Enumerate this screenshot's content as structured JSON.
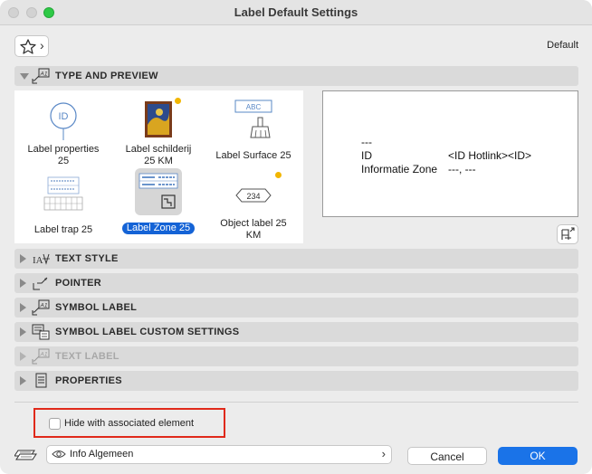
{
  "window": {
    "title": "Label Default Settings"
  },
  "toolbar": {
    "favorites_icon": "star-icon",
    "default_label": "Default"
  },
  "panels": {
    "type_and_preview": "TYPE AND PREVIEW",
    "text_style": "TEXT STYLE",
    "pointer": "POINTER",
    "symbol_label": "SYMBOL LABEL",
    "symbol_label_custom": "SYMBOL LABEL CUSTOM SETTINGS",
    "text_label": "TEXT LABEL",
    "properties": "PROPERTIES"
  },
  "label_types": [
    {
      "name": "Label properties 25",
      "line1": "Label properties",
      "line2": "25"
    },
    {
      "name": "Label schilderij 25 KM",
      "line1": "Label schilderij",
      "line2": "25 KM"
    },
    {
      "name": "Label Surface 25",
      "line1": "Label Surface 25",
      "line2": ""
    },
    {
      "name": "Label trap 25",
      "line1": "Label trap 25",
      "line2": ""
    },
    {
      "name": "Label Zone 25",
      "line1": "Label Zone 25",
      "line2": "",
      "selected": true
    },
    {
      "name": "Object label 25 KM",
      "line1": "Object label 25",
      "line2": "KM"
    }
  ],
  "thumb_text": {
    "id": "ID",
    "abc": "ABC",
    "num": "234"
  },
  "preview": {
    "line1": "---",
    "line2_left": "ID",
    "line2_right": "<ID Hotlink><ID>",
    "line3_left": "Informatie Zone",
    "line3_right": "---, ---"
  },
  "hide_option": {
    "label": "Hide with associated element",
    "checked": false
  },
  "layer": {
    "value": "Info Algemeen"
  },
  "buttons": {
    "cancel": "Cancel",
    "ok": "OK"
  },
  "colors": {
    "accent": "#1a73e8",
    "highlight_box": "#e0291a",
    "selection": "#1463d6"
  }
}
